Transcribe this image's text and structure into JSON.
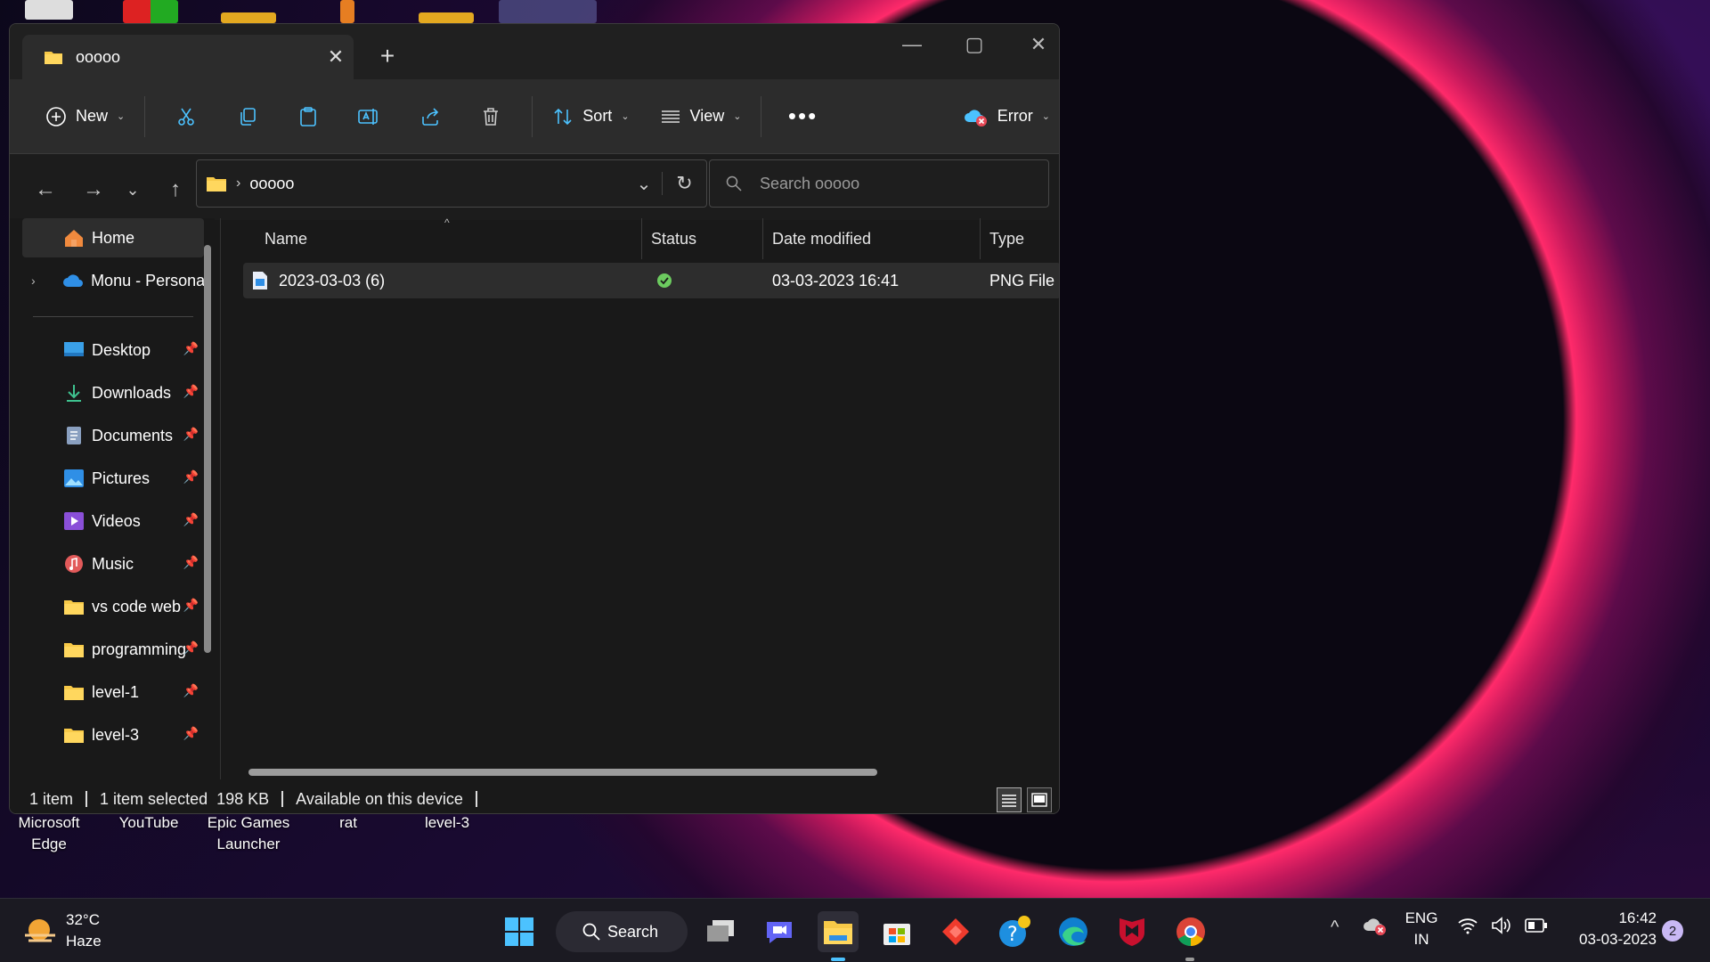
{
  "window": {
    "tab_title": "ooooo",
    "toolbar": {
      "new_label": "New",
      "sort_label": "Sort",
      "view_label": "View",
      "error_label": "Error"
    },
    "breadcrumb": "ooooo",
    "search_placeholder": "Search ooooo"
  },
  "sidebar": {
    "items": [
      {
        "label": "Home",
        "icon": "home-icon"
      },
      {
        "label": "Monu - Personal",
        "icon": "onedrive-icon"
      },
      {
        "label": "Desktop",
        "icon": "desktop-icon"
      },
      {
        "label": "Downloads",
        "icon": "download-icon"
      },
      {
        "label": "Documents",
        "icon": "documents-icon"
      },
      {
        "label": "Pictures",
        "icon": "pictures-icon"
      },
      {
        "label": "Videos",
        "icon": "videos-icon"
      },
      {
        "label": "Music",
        "icon": "music-icon"
      },
      {
        "label": "vs code web",
        "icon": "folder-icon"
      },
      {
        "label": "programming",
        "icon": "folder-icon"
      },
      {
        "label": "level-1",
        "icon": "folder-icon"
      },
      {
        "label": "level-3",
        "icon": "folder-icon"
      }
    ]
  },
  "file_list": {
    "columns": [
      "Name",
      "Status",
      "Date modified",
      "Type"
    ],
    "rows": [
      {
        "name": "2023-03-03 (6)",
        "status": "available",
        "date": "03-03-2023 16:41",
        "type": "PNG File"
      }
    ]
  },
  "statusbar": {
    "count": "1 item",
    "selected": "1 item selected  198 KB",
    "availability": "Available on this device"
  },
  "desktop": {
    "icons": [
      {
        "line1": "Microsoft",
        "line2": "Edge"
      },
      {
        "line1": "YouTube",
        "line2": ""
      },
      {
        "line1": "Epic Games",
        "line2": "Launcher"
      },
      {
        "line1": "rat",
        "line2": ""
      },
      {
        "line1": "level-3",
        "line2": ""
      }
    ]
  },
  "taskbar": {
    "weather_temp": "32°C",
    "weather_desc": "Haze",
    "search_label": "Search",
    "lang_line1": "ENG",
    "lang_line2": "IN",
    "time": "16:42",
    "date": "03-03-2023",
    "notification_count": "2"
  },
  "colors": {
    "accent": "#4cc2ff",
    "folder": "#f7c948",
    "ok": "#6ccb5f"
  }
}
